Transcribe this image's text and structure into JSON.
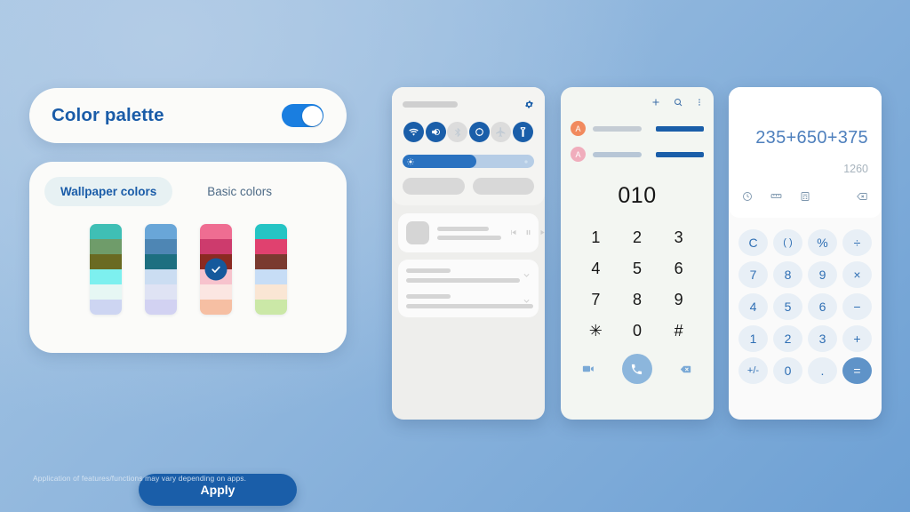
{
  "background": {
    "top_color": "#a6c6e4",
    "bottom_color": "#6da0d4"
  },
  "palette_panel": {
    "title": "Color palette",
    "toggle": {
      "state_label": "On",
      "on": true,
      "accent": "#1a7ee0"
    },
    "tabs": [
      {
        "label": "Wallpaper colors",
        "active": true
      },
      {
        "label": "Basic colors",
        "active": false
      }
    ],
    "swatches": [
      {
        "selected": false,
        "colors": [
          "#3fbfb5",
          "#6f9c6a",
          "#6a6a22",
          "#7df0ef",
          "#e6f7f4",
          "#cdd5f2"
        ]
      },
      {
        "selected": false,
        "colors": [
          "#69a6d8",
          "#4e86b4",
          "#1d6f80",
          "#cbddf2",
          "#dfe3f4",
          "#d2d2f2"
        ]
      },
      {
        "selected": true,
        "colors": [
          "#ef6d92",
          "#cd3b6d",
          "#8b2a22",
          "#f7c3cd",
          "#fbe6e2",
          "#f6bfa3"
        ]
      },
      {
        "selected": false,
        "colors": [
          "#25c4c4",
          "#e0416f",
          "#7a3a30",
          "#c7ddf6",
          "#fae6d4",
          "#cbe8a7"
        ]
      }
    ],
    "apply_label": "Apply"
  },
  "footer_note": "Application of features/functions may vary depending on apps.",
  "quick_settings": {
    "toggles": [
      {
        "name": "wifi",
        "on": true
      },
      {
        "name": "sound",
        "on": true
      },
      {
        "name": "bluetooth",
        "on": false
      },
      {
        "name": "auto-rotate",
        "on": true
      },
      {
        "name": "airplane-mode",
        "on": false
      },
      {
        "name": "flashlight",
        "on": true
      }
    ],
    "brightness_percent": 56,
    "media_controls": [
      "previous",
      "pause",
      "next"
    ],
    "notification_count": 2
  },
  "dialer": {
    "actions": [
      "add-contact",
      "search",
      "more-options"
    ],
    "suggestions": [
      {
        "initial": "A",
        "avatar_color": "#f18a5e"
      },
      {
        "initial": "A",
        "avatar_color": "#f0adbc"
      }
    ],
    "entered_number": "010",
    "keys": [
      "1",
      "2",
      "3",
      "4",
      "5",
      "6",
      "7",
      "8",
      "9",
      "✳",
      "0",
      "#"
    ],
    "bottom_actions": [
      "video-call",
      "call",
      "backspace"
    ]
  },
  "calculator": {
    "expression": "235+650+375",
    "result": "1260",
    "tools": [
      "history",
      "unit-converter",
      "scientific",
      "backspace"
    ],
    "keys": [
      {
        "label": "C",
        "type": "fn"
      },
      {
        "label": "( )",
        "type": "fn"
      },
      {
        "label": "%",
        "type": "fn"
      },
      {
        "label": "÷",
        "type": "op"
      },
      {
        "label": "7",
        "type": "num"
      },
      {
        "label": "8",
        "type": "num"
      },
      {
        "label": "9",
        "type": "num"
      },
      {
        "label": "×",
        "type": "op"
      },
      {
        "label": "4",
        "type": "num"
      },
      {
        "label": "5",
        "type": "num"
      },
      {
        "label": "6",
        "type": "num"
      },
      {
        "label": "−",
        "type": "op"
      },
      {
        "label": "1",
        "type": "num"
      },
      {
        "label": "2",
        "type": "num"
      },
      {
        "label": "3",
        "type": "num"
      },
      {
        "label": "+",
        "type": "op"
      },
      {
        "label": "+/-",
        "type": "fn"
      },
      {
        "label": "0",
        "type": "num"
      },
      {
        "label": ".",
        "type": "num"
      },
      {
        "label": "=",
        "type": "eq"
      }
    ]
  }
}
